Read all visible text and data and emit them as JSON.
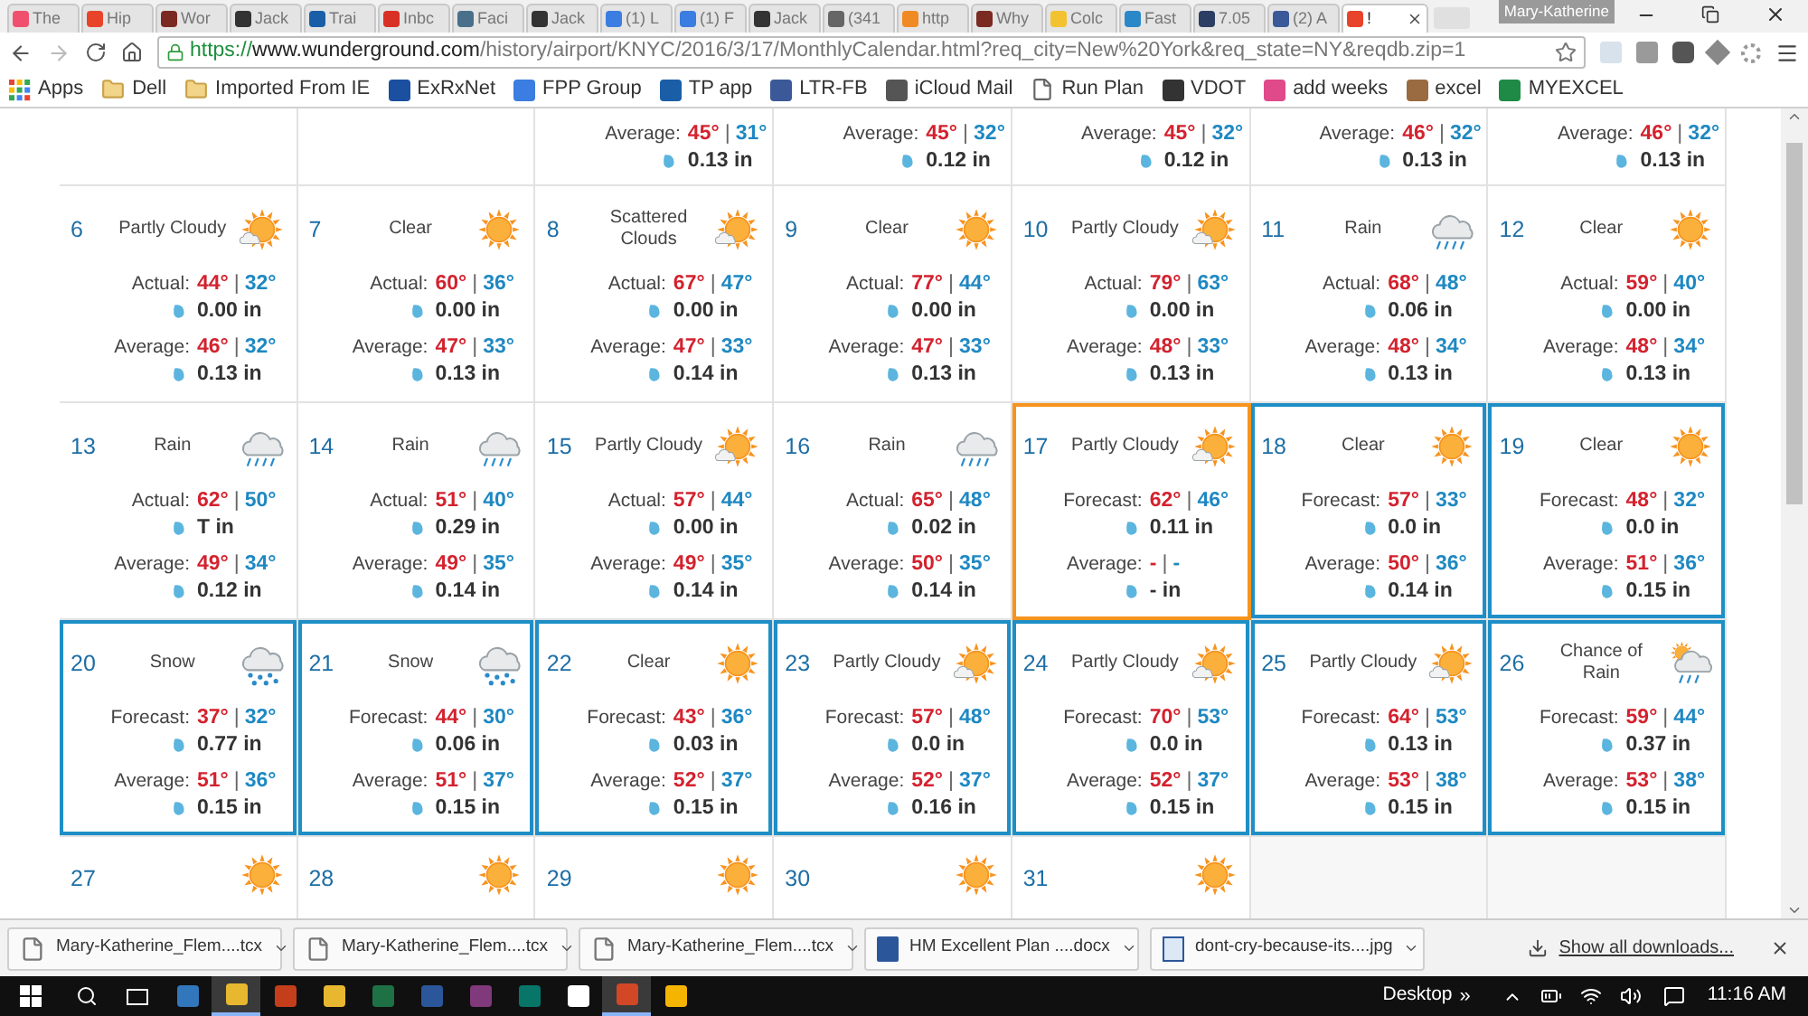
{
  "tabs": [
    {
      "title": "The",
      "color": "#f0506e",
      "selected": false
    },
    {
      "title": "Hip",
      "color": "#e8442c",
      "selected": false
    },
    {
      "title": "Wor",
      "color": "#7a2a20",
      "selected": false
    },
    {
      "title": "Jack",
      "color": "#333333",
      "selected": false
    },
    {
      "title": "Trai",
      "color": "#1b5ea8",
      "selected": false
    },
    {
      "title": "Inbc",
      "color": "#d93025",
      "selected": false
    },
    {
      "title": "Faci",
      "color": "#4a6f8a",
      "selected": false
    },
    {
      "title": "Jack",
      "color": "#333333",
      "selected": false
    },
    {
      "title": "(1) L",
      "color": "#3b7de0",
      "selected": false
    },
    {
      "title": "(1) F",
      "color": "#3b7de0",
      "selected": false
    },
    {
      "title": "Jack",
      "color": "#333333",
      "selected": false
    },
    {
      "title": "(341",
      "color": "#666666",
      "selected": false
    },
    {
      "title": "http",
      "color": "#f08a24",
      "selected": false
    },
    {
      "title": "Why",
      "color": "#7a2a20",
      "selected": false
    },
    {
      "title": "Colc",
      "color": "#f2c230",
      "selected": false
    },
    {
      "title": "Fast",
      "color": "#2a88c8",
      "selected": false
    },
    {
      "title": "7.05",
      "color": "#2c3e63",
      "selected": false
    },
    {
      "title": "(2) A",
      "color": "#3b5998",
      "selected": false
    },
    {
      "title": "!",
      "color": "#e8442c",
      "selected": true
    }
  ],
  "profile": "Mary-Katherine",
  "address": {
    "scheme": "https://",
    "host": "www.wunderground.com",
    "path": "/history/airport/KNYC/2016/3/17/MonthlyCalendar.html?req_city=New%20York&req_state=NY&reqdb.zip=1"
  },
  "bookmarks": [
    {
      "kind": "apps",
      "label": "Apps"
    },
    {
      "kind": "folder",
      "label": "Dell"
    },
    {
      "kind": "folder",
      "label": "Imported From IE"
    },
    {
      "kind": "site",
      "label": "ExRxNet",
      "color": "#1b4fa0"
    },
    {
      "kind": "site",
      "label": "FPP Group",
      "color": "#3b7de0"
    },
    {
      "kind": "site",
      "label": "TP app",
      "color": "#1b5ea8"
    },
    {
      "kind": "site",
      "label": "LTR-FB",
      "color": "#3b5998"
    },
    {
      "kind": "site",
      "label": "iCloud Mail",
      "color": "#555555"
    },
    {
      "kind": "page",
      "label": "Run Plan"
    },
    {
      "kind": "site",
      "label": "VDOT",
      "color": "#333333"
    },
    {
      "kind": "site",
      "label": "add weeks",
      "color": "#e04a8a"
    },
    {
      "kind": "site",
      "label": "excel",
      "color": "#9a6a40"
    },
    {
      "kind": "site",
      "label": "MYEXCEL",
      "color": "#1e8a45"
    }
  ],
  "calendar": {
    "rows": [
      [
        {},
        {},
        {
          "average": {
            "label": "Average:",
            "high": "45°",
            "sep": "|",
            "low": "31°",
            "precip": "0.13 in"
          }
        },
        {
          "average": {
            "label": "Average:",
            "high": "45°",
            "sep": "|",
            "low": "32°",
            "precip": "0.12 in"
          }
        },
        {
          "average": {
            "label": "Average:",
            "high": "45°",
            "sep": "|",
            "low": "32°",
            "precip": "0.12 in"
          }
        },
        {
          "average": {
            "label": "Average:",
            "high": "46°",
            "sep": "|",
            "low": "32°",
            "precip": "0.13 in"
          }
        },
        {
          "average": {
            "label": "Average:",
            "high": "46°",
            "sep": "|",
            "low": "32°",
            "precip": "0.13 in"
          }
        }
      ],
      [
        {
          "day": "6",
          "condition": "Partly Cloudy",
          "kind": "partly",
          "today": false,
          "forecast": false,
          "actual": {
            "label": "Actual:",
            "high": "44°",
            "sep": "|",
            "low": "32°",
            "precip": "0.00 in"
          },
          "average": {
            "label": "Average:",
            "high": "46°",
            "sep": "|",
            "low": "32°",
            "precip": "0.13 in"
          }
        },
        {
          "day": "7",
          "condition": "Clear",
          "kind": "sun",
          "today": false,
          "forecast": false,
          "actual": {
            "label": "Actual:",
            "high": "60°",
            "sep": "|",
            "low": "36°",
            "precip": "0.00 in"
          },
          "average": {
            "label": "Average:",
            "high": "47°",
            "sep": "|",
            "low": "33°",
            "precip": "0.13 in"
          }
        },
        {
          "day": "8",
          "condition": "Scattered Clouds",
          "kind": "partly",
          "today": false,
          "forecast": false,
          "actual": {
            "label": "Actual:",
            "high": "67°",
            "sep": "|",
            "low": "47°",
            "precip": "0.00 in"
          },
          "average": {
            "label": "Average:",
            "high": "47°",
            "sep": "|",
            "low": "33°",
            "precip": "0.14 in"
          }
        },
        {
          "day": "9",
          "condition": "Clear",
          "kind": "sun",
          "today": false,
          "forecast": false,
          "actual": {
            "label": "Actual:",
            "high": "77°",
            "sep": "|",
            "low": "44°",
            "precip": "0.00 in"
          },
          "average": {
            "label": "Average:",
            "high": "47°",
            "sep": "|",
            "low": "33°",
            "precip": "0.13 in"
          }
        },
        {
          "day": "10",
          "condition": "Partly Cloudy",
          "kind": "partly",
          "today": false,
          "forecast": false,
          "actual": {
            "label": "Actual:",
            "high": "79°",
            "sep": "|",
            "low": "63°",
            "precip": "0.00 in"
          },
          "average": {
            "label": "Average:",
            "high": "48°",
            "sep": "|",
            "low": "33°",
            "precip": "0.13 in"
          }
        },
        {
          "day": "11",
          "condition": "Rain",
          "kind": "rain",
          "today": false,
          "forecast": false,
          "actual": {
            "label": "Actual:",
            "high": "68°",
            "sep": "|",
            "low": "48°",
            "precip": "0.06 in"
          },
          "average": {
            "label": "Average:",
            "high": "48°",
            "sep": "|",
            "low": "34°",
            "precip": "0.13 in"
          }
        },
        {
          "day": "12",
          "condition": "Clear",
          "kind": "sun",
          "today": false,
          "forecast": false,
          "actual": {
            "label": "Actual:",
            "high": "59°",
            "sep": "|",
            "low": "40°",
            "precip": "0.00 in"
          },
          "average": {
            "label": "Average:",
            "high": "48°",
            "sep": "|",
            "low": "34°",
            "precip": "0.13 in"
          }
        }
      ],
      [
        {
          "day": "13",
          "condition": "Rain",
          "kind": "rain",
          "today": false,
          "forecast": false,
          "actual": {
            "label": "Actual:",
            "high": "62°",
            "sep": "|",
            "low": "50°",
            "precip": "T in"
          },
          "average": {
            "label": "Average:",
            "high": "49°",
            "sep": "|",
            "low": "34°",
            "precip": "0.12 in"
          }
        },
        {
          "day": "14",
          "condition": "Rain",
          "kind": "rain",
          "today": false,
          "forecast": false,
          "actual": {
            "label": "Actual:",
            "high": "51°",
            "sep": "|",
            "low": "40°",
            "precip": "0.29 in"
          },
          "average": {
            "label": "Average:",
            "high": "49°",
            "sep": "|",
            "low": "35°",
            "precip": "0.14 in"
          }
        },
        {
          "day": "15",
          "condition": "Partly Cloudy",
          "kind": "partly",
          "today": false,
          "forecast": false,
          "actual": {
            "label": "Actual:",
            "high": "57°",
            "sep": "|",
            "low": "44°",
            "precip": "0.00 in"
          },
          "average": {
            "label": "Average:",
            "high": "49°",
            "sep": "|",
            "low": "35°",
            "precip": "0.14 in"
          }
        },
        {
          "day": "16",
          "condition": "Rain",
          "kind": "rain",
          "today": false,
          "forecast": false,
          "actual": {
            "label": "Actual:",
            "high": "65°",
            "sep": "|",
            "low": "48°",
            "precip": "0.02 in"
          },
          "average": {
            "label": "Average:",
            "high": "50°",
            "sep": "|",
            "low": "35°",
            "precip": "0.14 in"
          }
        },
        {
          "day": "17",
          "condition": "Partly Cloudy",
          "kind": "partly",
          "today": true,
          "forecast": false,
          "actual": {
            "label": "Forecast:",
            "high": "62°",
            "sep": "|",
            "low": "46°",
            "precip": "0.11 in"
          },
          "average": {
            "label": "Average:",
            "high": "-",
            "sep": "|",
            "low": "-",
            "precip": "- in"
          }
        },
        {
          "day": "18",
          "condition": "Clear",
          "kind": "sun",
          "today": false,
          "forecast": true,
          "actual": {
            "label": "Forecast:",
            "high": "57°",
            "sep": "|",
            "low": "33°",
            "precip": "0.0 in"
          },
          "average": {
            "label": "Average:",
            "high": "50°",
            "sep": "|",
            "low": "36°",
            "precip": "0.14 in"
          }
        },
        {
          "day": "19",
          "condition": "Clear",
          "kind": "sun",
          "today": false,
          "forecast": true,
          "actual": {
            "label": "Forecast:",
            "high": "48°",
            "sep": "|",
            "low": "32°",
            "precip": "0.0 in"
          },
          "average": {
            "label": "Average:",
            "high": "51°",
            "sep": "|",
            "low": "36°",
            "precip": "0.15 in"
          }
        }
      ],
      [
        {
          "day": "20",
          "condition": "Snow",
          "kind": "snow",
          "today": false,
          "forecast": true,
          "actual": {
            "label": "Forecast:",
            "high": "37°",
            "sep": "|",
            "low": "32°",
            "precip": "0.77 in"
          },
          "average": {
            "label": "Average:",
            "high": "51°",
            "sep": "|",
            "low": "36°",
            "precip": "0.15 in"
          }
        },
        {
          "day": "21",
          "condition": "Snow",
          "kind": "snow",
          "today": false,
          "forecast": true,
          "actual": {
            "label": "Forecast:",
            "high": "44°",
            "sep": "|",
            "low": "30°",
            "precip": "0.06 in"
          },
          "average": {
            "label": "Average:",
            "high": "51°",
            "sep": "|",
            "low": "37°",
            "precip": "0.15 in"
          }
        },
        {
          "day": "22",
          "condition": "Clear",
          "kind": "sun",
          "today": false,
          "forecast": true,
          "actual": {
            "label": "Forecast:",
            "high": "43°",
            "sep": "|",
            "low": "36°",
            "precip": "0.03 in"
          },
          "average": {
            "label": "Average:",
            "high": "52°",
            "sep": "|",
            "low": "37°",
            "precip": "0.15 in"
          }
        },
        {
          "day": "23",
          "condition": "Partly Cloudy",
          "kind": "partly",
          "today": false,
          "forecast": true,
          "actual": {
            "label": "Forecast:",
            "high": "57°",
            "sep": "|",
            "low": "48°",
            "precip": "0.0 in"
          },
          "average": {
            "label": "Average:",
            "high": "52°",
            "sep": "|",
            "low": "37°",
            "precip": "0.16 in"
          }
        },
        {
          "day": "24",
          "condition": "Partly Cloudy",
          "kind": "partly",
          "today": false,
          "forecast": true,
          "actual": {
            "label": "Forecast:",
            "high": "70°",
            "sep": "|",
            "low": "53°",
            "precip": "0.0 in"
          },
          "average": {
            "label": "Average:",
            "high": "52°",
            "sep": "|",
            "low": "37°",
            "precip": "0.15 in"
          }
        },
        {
          "day": "25",
          "condition": "Partly Cloudy",
          "kind": "partly",
          "today": false,
          "forecast": true,
          "actual": {
            "label": "Forecast:",
            "high": "64°",
            "sep": "|",
            "low": "53°",
            "precip": "0.13 in"
          },
          "average": {
            "label": "Average:",
            "high": "53°",
            "sep": "|",
            "low": "38°",
            "precip": "0.15 in"
          }
        },
        {
          "day": "26",
          "condition": "Chance of Rain",
          "kind": "chance_rain",
          "today": false,
          "forecast": true,
          "actual": {
            "label": "Forecast:",
            "high": "59°",
            "sep": "|",
            "low": "44°",
            "precip": "0.37 in"
          },
          "average": {
            "label": "Average:",
            "high": "53°",
            "sep": "|",
            "low": "38°",
            "precip": "0.15 in"
          }
        }
      ],
      [
        {
          "day": "27",
          "kind": "sun"
        },
        {
          "day": "28",
          "kind": "sun"
        },
        {
          "day": "29",
          "kind": "sun"
        },
        {
          "day": "30",
          "kind": "sun"
        },
        {
          "day": "31",
          "kind": "sun"
        },
        {},
        {}
      ]
    ]
  },
  "downloads": {
    "items": [
      {
        "kind": "file",
        "name": "Mary-Katherine_Flem....tcx"
      },
      {
        "kind": "file",
        "name": "Mary-Katherine_Flem....tcx"
      },
      {
        "kind": "file",
        "name": "Mary-Katherine_Flem....tcx"
      },
      {
        "kind": "word",
        "name": "HM Excellent Plan ....docx"
      },
      {
        "kind": "image",
        "name": "dont-cry-because-its....jpg"
      }
    ],
    "show_all": "Show all downloads..."
  },
  "taskbar": {
    "apps": [
      {
        "color": "#3277bc",
        "selected": false
      },
      {
        "color": "#e8b730",
        "selected": true
      },
      {
        "color": "#c43e1c",
        "selected": false
      },
      {
        "color": "#e8b730",
        "selected": false
      },
      {
        "color": "#1e7145",
        "selected": false
      },
      {
        "color": "#2b579a",
        "selected": false
      },
      {
        "color": "#80397b",
        "selected": false
      },
      {
        "color": "#077568",
        "selected": false
      },
      {
        "color": "#ffffff",
        "selected": false
      },
      {
        "color": "#d24726",
        "selected": true
      },
      {
        "color": "#f5b400",
        "selected": false
      }
    ],
    "desktop": "Desktop",
    "chevron": "»",
    "time": "11:16 AM"
  }
}
